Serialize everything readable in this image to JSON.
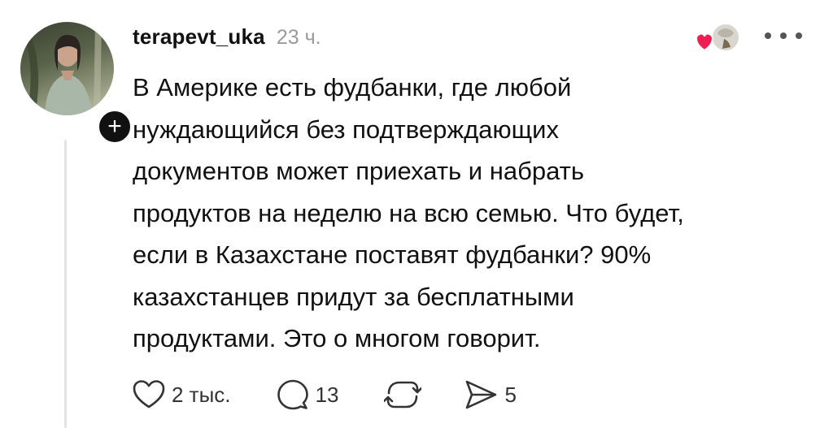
{
  "post": {
    "username": "terapevt_uka",
    "time": "23 ч.",
    "text": "В Америке есть фудбанки, где любой\nнуждающийся без подтверждающих\nдокументов может приехать и набрать\nпродуктов на неделю на всю семью. Что будет,\nесли в Казахстане поставят фудбанки?  90%\nказахстанцев придут за бесплатными\nпродуктами. Это о многом говорит.",
    "follow_symbol": "+"
  },
  "actions": {
    "likes": "2 тыс.",
    "replies": "13",
    "shares": "5"
  },
  "icons": {
    "like": "heart-outline-icon",
    "reply": "speech-bubble-icon",
    "repost": "repost-arrows-icon",
    "share": "send-arrow-icon",
    "more": "more-dots-icon",
    "reaction": "heart-filled-icon"
  },
  "colors": {
    "text": "#111111",
    "muted": "#9a9a9a",
    "heart": "#ee1d52",
    "divider": "#e3e3e3"
  }
}
